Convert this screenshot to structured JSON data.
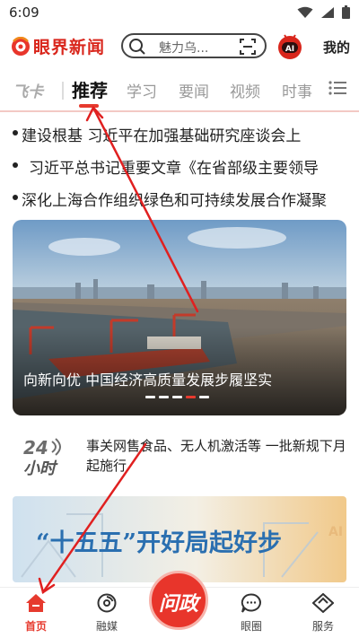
{
  "status_bar": {
    "time": "6:09"
  },
  "header": {
    "app_name": "眼界新闻",
    "search_text": "魅力乌...",
    "ai_badge": "AI",
    "mine_label": "我的"
  },
  "tabs": {
    "feika": "飞卡",
    "items": [
      "推荐",
      "学习",
      "要闻",
      "视频",
      "时事"
    ]
  },
  "headlines": [
    "建设根基   习近平在加强基础研究座谈会上",
    "习近平总书记重要文章《在省部级主要领导",
    "深化上海合作组织绿色和可持续发展合作凝聚"
  ],
  "banner": {
    "caption": "向新向优 中国经济高质量发展步履坚实",
    "dot_count": 5,
    "active_dot": 3
  },
  "news24": {
    "logo_top": "24",
    "logo_bottom": "小时",
    "text": "事关网售食品、无人机激活等 一批新规下月起施行"
  },
  "promo": {
    "text": "“十五五”开好局起好步",
    "watermark": "AI"
  },
  "bottom_nav": {
    "home": "首页",
    "media": "融媒",
    "center": "问政",
    "circle": "眼圈",
    "service": "服务"
  },
  "colors": {
    "accent": "#e63a2e",
    "brand": "#d9261c",
    "annotation": "#e02020"
  }
}
